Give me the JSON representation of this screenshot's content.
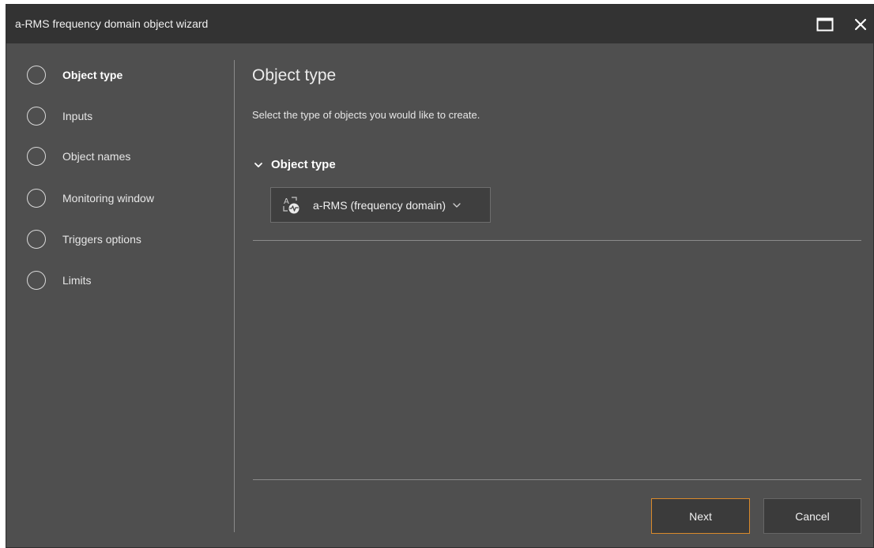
{
  "window": {
    "title": "a-RMS frequency domain object wizard",
    "maximize_icon": "maximize-icon",
    "close_icon": "close-icon"
  },
  "steps": [
    {
      "label": "Object type",
      "active": true
    },
    {
      "label": "Inputs",
      "active": false
    },
    {
      "label": "Object names",
      "active": false
    },
    {
      "label": "Monitoring window",
      "active": false
    },
    {
      "label": "Triggers options",
      "active": false
    },
    {
      "label": "Limits",
      "active": false
    }
  ],
  "main": {
    "title": "Object type",
    "description": "Select the type of objects you would like to create.",
    "section": {
      "title": "Object type",
      "expanded": true,
      "chevron_icon": "chevron-down-icon"
    },
    "dropdown": {
      "value": "a-RMS (frequency domain)",
      "icon": "a-rms-object-icon",
      "chevron_icon": "chevron-down-icon"
    }
  },
  "buttons": {
    "next": "Next",
    "cancel": "Cancel"
  },
  "colors": {
    "window_bg": "#4f4f4f",
    "titlebar_bg": "#333333",
    "accent": "#d98a2b",
    "divider": "#8a8a8a"
  }
}
